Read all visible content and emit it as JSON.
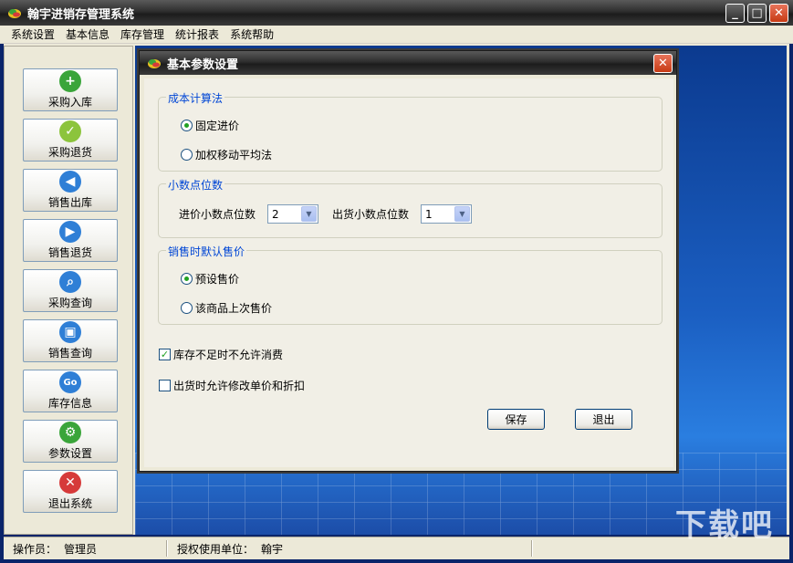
{
  "app": {
    "title": "翰宇进销存管理系统"
  },
  "menu": [
    "系统设置",
    "基本信息",
    "库存管理",
    "统计报表",
    "系统帮助"
  ],
  "sidebar": {
    "items": [
      {
        "label": "采购入库",
        "icon": "plus-icon",
        "color": "#3aa53a",
        "glyph": "+"
      },
      {
        "label": "采购退货",
        "icon": "check-icon",
        "color": "#8cc43c",
        "glyph": "✓"
      },
      {
        "label": "销售出库",
        "icon": "arrow-left-icon",
        "color": "#2f7fd6",
        "glyph": "◀"
      },
      {
        "label": "销售退货",
        "icon": "arrow-right-icon",
        "color": "#2f7fd6",
        "glyph": "▶"
      },
      {
        "label": "采购查询",
        "icon": "search-icon",
        "color": "#2f7fd6",
        "glyph": "⌕"
      },
      {
        "label": "销售查询",
        "icon": "device-icon",
        "color": "#2f7fd6",
        "glyph": "▣"
      },
      {
        "label": "库存信息",
        "icon": "go-icon",
        "color": "#2f7fd6",
        "glyph": "Go"
      },
      {
        "label": "参数设置",
        "icon": "gear-icon",
        "color": "#3aa53a",
        "glyph": "⚙"
      },
      {
        "label": "退出系统",
        "icon": "close-icon",
        "color": "#d63a3a",
        "glyph": "✕"
      }
    ]
  },
  "dialog": {
    "title": "基本参数设置",
    "cost_group": {
      "label": "成本计算法",
      "options": [
        "固定进价",
        "加权移动平均法"
      ],
      "selected": 0
    },
    "decimal_group": {
      "label": "小数点位数",
      "purchase_label": "进价小数点位数",
      "purchase_value": "2",
      "sale_label": "出货小数点位数",
      "sale_value": "1"
    },
    "price_group": {
      "label": "销售时默认售价",
      "options": [
        "预设售价",
        "该商品上次售价"
      ],
      "selected": 0
    },
    "check_stock": {
      "label": "库存不足时不允许消费",
      "checked": true
    },
    "check_modify": {
      "label": "出货时允许修改单价和折扣",
      "checked": false
    },
    "save_label": "保存",
    "exit_label": "退出"
  },
  "status": {
    "operator_label": "操作员：",
    "operator_value": "管理员",
    "licensee_label": "授权使用单位：",
    "licensee_value": "翰宇"
  },
  "watermark": "下载吧"
}
